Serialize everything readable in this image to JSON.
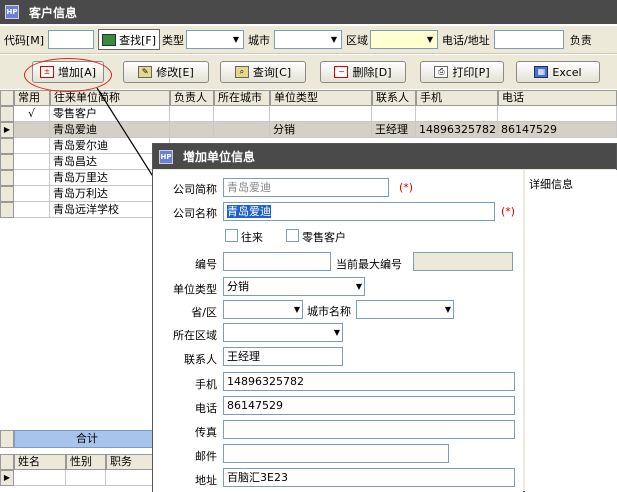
{
  "window": {
    "title": "客户信息",
    "app_icon": "HP"
  },
  "filter": {
    "code_label": "代码[M]",
    "find_button": "查找[F]",
    "type_label": "类型",
    "city_label": "城市",
    "area_label": "区域",
    "phone_addr_label": "电话/地址",
    "owner_label": "负责"
  },
  "toolbar": {
    "add": "增加[A]",
    "edit": "修改[E]",
    "query": "查询[C]",
    "delete": "删除[D]",
    "print": "打印[P]",
    "excel": "Excel"
  },
  "grid": {
    "columns": [
      "常用",
      "往来单位简称",
      "负责人",
      "所在城市",
      "单位类型",
      "联系人",
      "手机",
      "电话"
    ],
    "rows": [
      {
        "common": "√",
        "name": "零售客户",
        "owner": "",
        "city": "",
        "type": "",
        "contact": "",
        "mobile": "",
        "phone": ""
      },
      {
        "common": "",
        "name": "青岛爱迪",
        "owner": "",
        "city": "",
        "type": "分销",
        "contact": "王经理",
        "mobile": "14896325782",
        "phone": "86147529"
      },
      {
        "common": "",
        "name": "青岛爱尔迪",
        "owner": "",
        "city": "",
        "type": "",
        "contact": "",
        "mobile": "",
        "phone": ""
      },
      {
        "common": "",
        "name": "青岛昌达",
        "owner": "",
        "city": "",
        "type": "",
        "contact": "",
        "mobile": "",
        "phone": ""
      },
      {
        "common": "",
        "name": "青岛万里达",
        "owner": "",
        "city": "",
        "type": "",
        "contact": "",
        "mobile": "",
        "phone": ""
      },
      {
        "common": "",
        "name": "青岛万利达",
        "owner": "",
        "city": "",
        "type": "",
        "contact": "",
        "mobile": "",
        "phone": ""
      },
      {
        "common": "",
        "name": "青岛远洋学校",
        "owner": "",
        "city": "",
        "type": "",
        "contact": "",
        "mobile": "",
        "phone": ""
      }
    ],
    "total_label": "合计"
  },
  "lower_grid": {
    "columns": [
      "姓名",
      "性别",
      "职务"
    ]
  },
  "dialog": {
    "title": "增加单位信息",
    "short_name_label": "公司简称",
    "short_name_value": "青岛爱迪",
    "full_name_label": "公司名称",
    "full_name_value": "青岛爱迪",
    "required_mark": "(*)",
    "check_wanglai": "往来",
    "check_retail": "零售客户",
    "number_label": "编号",
    "max_number_label": "当前最大编号",
    "unit_type_label": "单位类型",
    "unit_type_value": "分销",
    "province_label": "省/区",
    "city_name_label": "城市名称",
    "area_label": "所在区域",
    "contact_label": "联系人",
    "contact_value": "王经理",
    "mobile_label": "手机",
    "mobile_value": "14896325782",
    "phone_label": "电话",
    "phone_value": "86147529",
    "fax_label": "传真",
    "email_label": "邮件",
    "address_label": "地址",
    "address_value": "百脑汇3E23",
    "detail_label": "详细信息"
  },
  "colors": {
    "titlebar": "#4a4a4a",
    "form_bg": "#ece9d8",
    "accent_red": "#d22",
    "selection": "#1c5fd0"
  }
}
